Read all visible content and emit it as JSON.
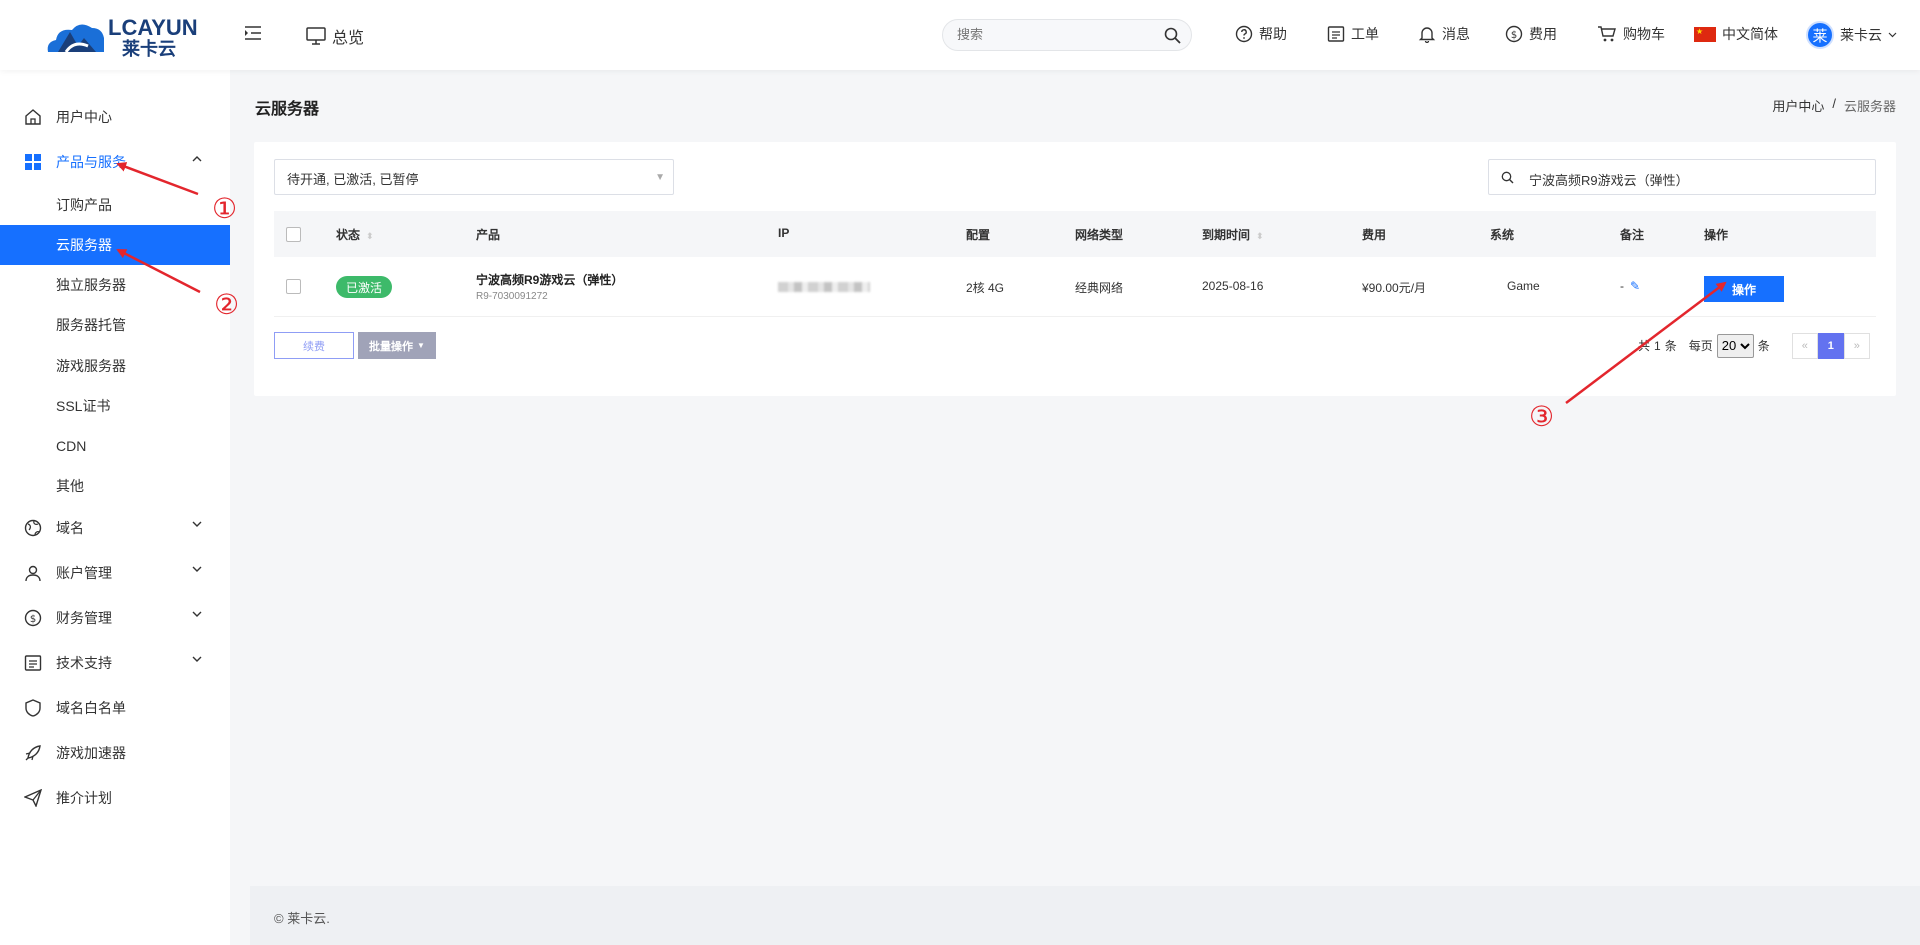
{
  "header": {
    "logo_text": "LCAYUN",
    "logo_sub": "莱卡云",
    "overview_label": "总览",
    "search_placeholder": "搜索",
    "nav": {
      "help": "帮助",
      "ticket": "工单",
      "message": "消息",
      "billing": "费用",
      "cart": "购物车",
      "language": "中文简体",
      "user_initial": "莱",
      "user_name": "莱卡云"
    }
  },
  "sidebar": {
    "user_center": "用户中心",
    "products": "产品与服务",
    "sub": [
      "订购产品",
      "云服务器",
      "独立服务器",
      "服务器托管",
      "游戏服务器",
      "SSL证书",
      "CDN",
      "其他"
    ],
    "domain": "域名",
    "account": "账户管理",
    "finance": "财务管理",
    "support": "技术支持",
    "whitelist": "域名白名单",
    "accelerator": "游戏加速器",
    "referral": "推介计划"
  },
  "page": {
    "title": "云服务器",
    "breadcrumb": [
      "用户中心",
      "/",
      "云服务器"
    ]
  },
  "filters": {
    "status": "待开通, 已激活, 已暂停",
    "search_value": "宁波高频R9游戏云（弹性）"
  },
  "table": {
    "headers": [
      "状态",
      "产品",
      "IP",
      "配置",
      "网络类型",
      "到期时间",
      "费用",
      "系统",
      "备注",
      "操作"
    ],
    "rows": [
      {
        "status": "已激活",
        "product": "宁波高频R9游戏云（弹性）",
        "product_id": "R9-7030091272",
        "config": "2核 4G",
        "network": "经典网络",
        "expire": "2025-08-16",
        "fee": "¥90.00元/月",
        "system": "Game",
        "note": "-",
        "action": "操作"
      }
    ]
  },
  "footer_actions": {
    "renew": "续费",
    "batch": "批量操作"
  },
  "pagination": {
    "total_prefix": "共",
    "total": "1",
    "total_suffix": "条",
    "per_page_label": "每页",
    "per_page": "20",
    "per_page_suffix": "条",
    "prev": "«",
    "current": "1",
    "next": "»"
  },
  "footer": {
    "copyright": "© 莱卡云."
  },
  "annotations": [
    "①",
    "②",
    "③"
  ],
  "colors": {
    "primary": "#1670ff",
    "success": "#3dba6a",
    "annotation": "#e3262d",
    "pager_active": "#6372f0"
  }
}
